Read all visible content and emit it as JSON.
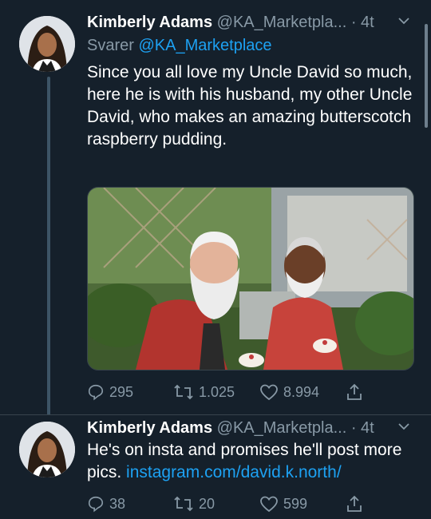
{
  "tweets": [
    {
      "name": "Kimberly Adams",
      "handle": "@KA_Marketpla...",
      "time": "· 4t",
      "reply_prefix": "Svarer",
      "reply_handle": "@KA_Marketplace",
      "text": "Since you all love my Uncle David so much, here he is with his husband, my other Uncle David, who makes an amazing butterscotch raspberry pudding.",
      "replies": "295",
      "retweets": "1.025",
      "likes": "8.994"
    },
    {
      "name": "Kimberly Adams",
      "handle": "@KA_Marketpla...",
      "time": "· 4t",
      "text": "He's on insta and promises he'll post more pics.",
      "link": "instagram.com/david.k.north/",
      "replies": "38",
      "retweets": "20",
      "likes": "599"
    }
  ],
  "icons": {
    "reply": "reply-icon",
    "retweet": "retweet-icon",
    "like": "heart-icon",
    "share": "share-icon",
    "menu": "chevron-down-icon"
  },
  "colors": {
    "background": "#15202b",
    "accent": "#1da1f2",
    "muted": "#8899a6"
  }
}
